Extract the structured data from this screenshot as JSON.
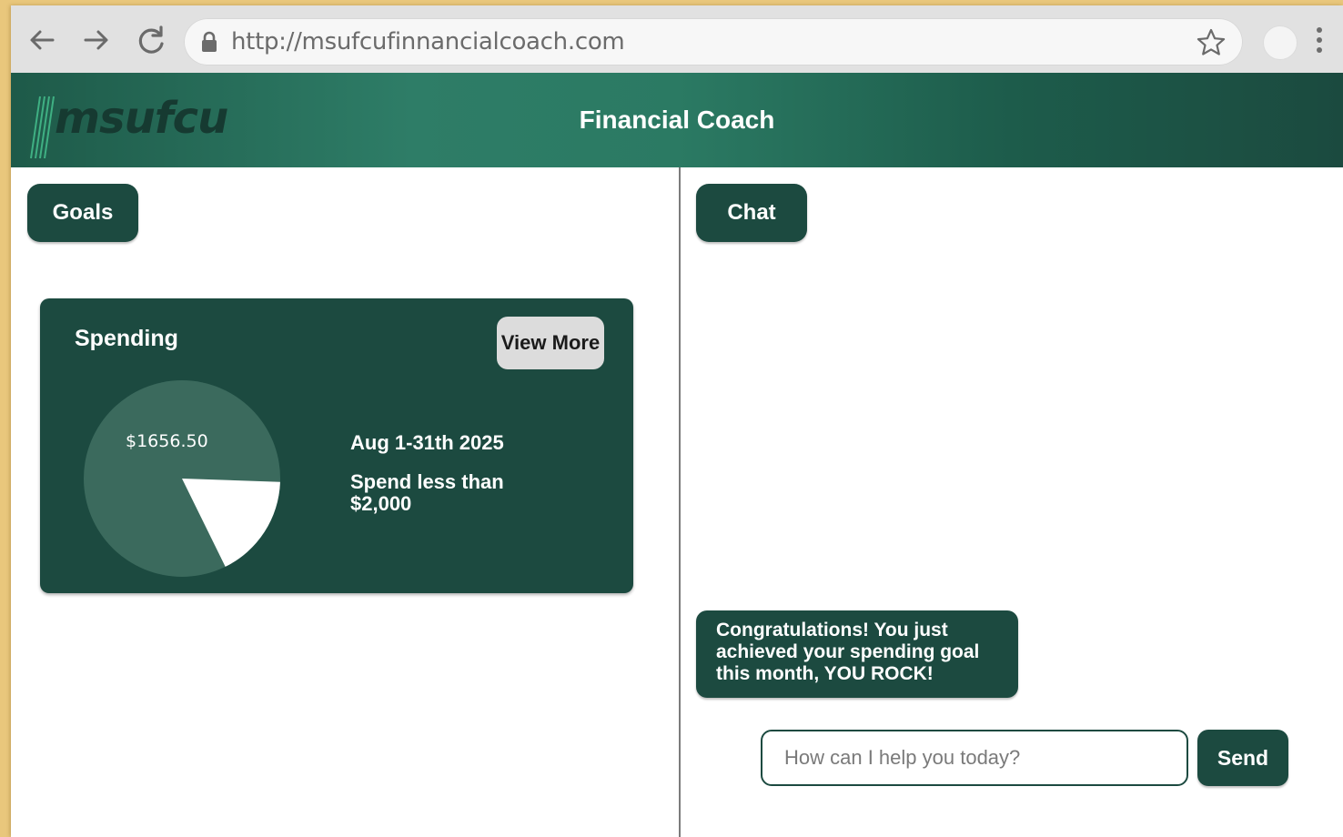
{
  "browser": {
    "back_icon": "arrow-left-icon",
    "forward_icon": "arrow-right-icon",
    "reload_icon": "reload-icon",
    "lock_icon": "lock-icon",
    "url": "http://msufcufinnancialcoach.com",
    "bookmark_icon": "star-icon",
    "menu_icon": "kebab-menu-icon"
  },
  "header": {
    "logo": "msufcu",
    "title": "Financial Coach"
  },
  "goals_panel": {
    "tab_label": "Goals",
    "card": {
      "title": "Spending",
      "view_more_label": "View More",
      "amount": "$1656.50",
      "date_range": "Aug 1-31th 2025",
      "goal": "Spend less than $2,000",
      "spent_fraction": 0.8283
    }
  },
  "chat_panel": {
    "tab_label": "Chat",
    "messages": [
      {
        "text": "Congratulations! You just achieved your spending goal this month, YOU ROCK!"
      }
    ],
    "input_placeholder": "How can I help you today?",
    "send_label": "Send"
  },
  "colors": {
    "brand_dark": "#1c4a40",
    "brand_mid": "#2e7d67",
    "pie_spent": "#3b6a5d",
    "pie_remaining": "#ffffff",
    "background": "#e9c77c"
  }
}
